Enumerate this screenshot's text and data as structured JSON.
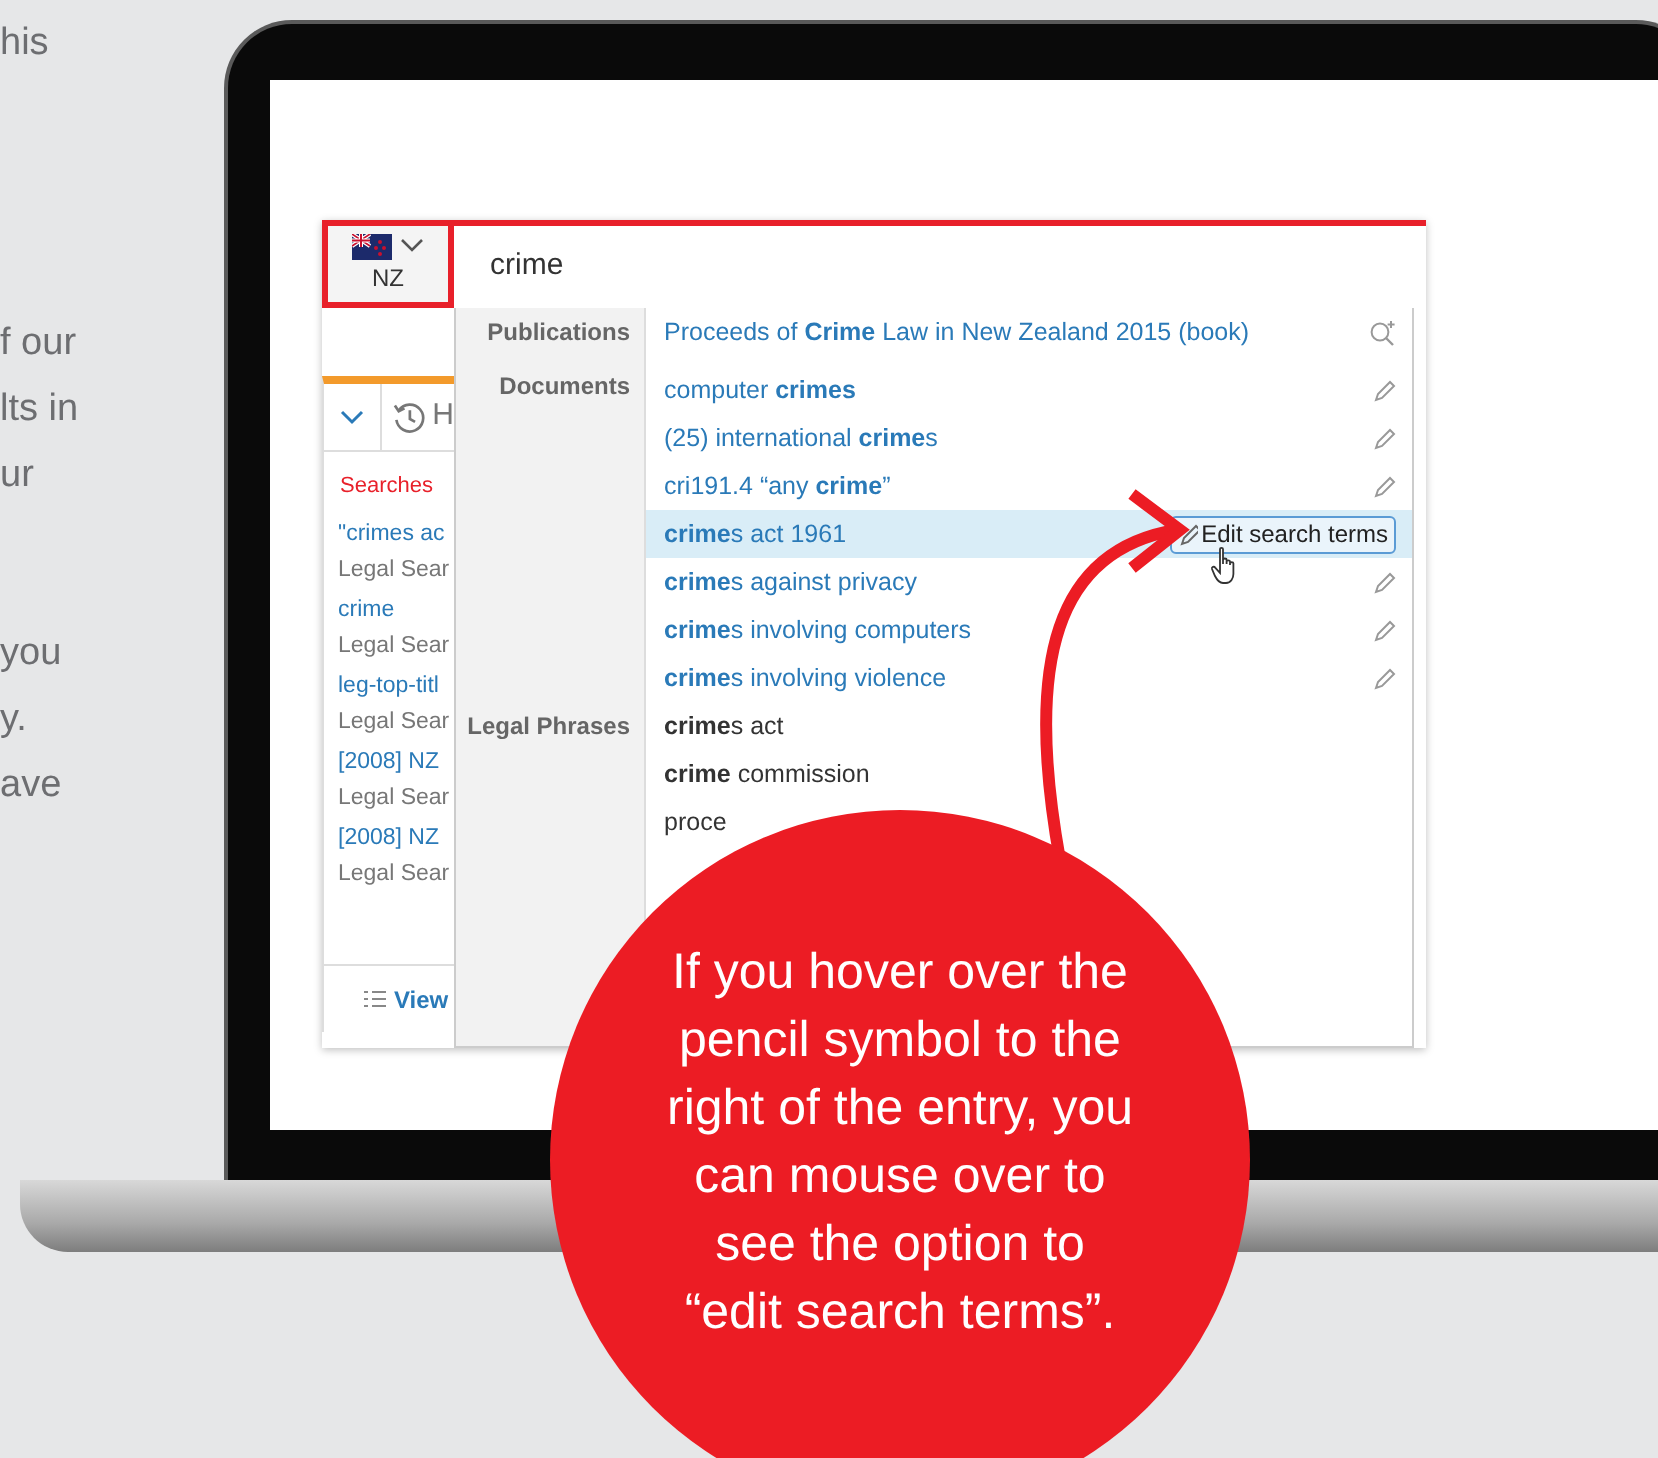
{
  "left_text": {
    "paragraphs": [
      [
        "his"
      ],
      [
        "f our",
        "lts in",
        "ur"
      ],
      [
        "you",
        "y.",
        "ave"
      ]
    ]
  },
  "app": {
    "country": {
      "code": "NZ"
    },
    "search": {
      "value": "crime"
    },
    "history_panel": {
      "title": "H",
      "searches_label": "Searches",
      "footer": "View",
      "items": [
        {
          "title": "\"crimes ac",
          "source": "Legal Sear"
        },
        {
          "title": "crime",
          "source": "Legal Sear"
        },
        {
          "title": "leg-top-titl",
          "source": "Legal Sear"
        },
        {
          "title": "[2008] NZ",
          "source": "Legal Sear"
        },
        {
          "title": "[2008] NZ",
          "source": "Legal Sear"
        }
      ]
    },
    "suggestions": [
      {
        "category": "Publications",
        "items": [
          {
            "text": "Proceeds of **Crime** Law in New Zealand 2015 (book)",
            "kind": "publication",
            "selected": false
          }
        ]
      },
      {
        "category": "Documents",
        "items": [
          {
            "text": "computer **crimes**",
            "kind": "document",
            "selected": false
          },
          {
            "text": "(25) international **crime**s",
            "kind": "document",
            "selected": false
          },
          {
            "text": "cri191.4 “any **crime**”",
            "kind": "document",
            "selected": false
          },
          {
            "text": "**crime**s act 1961",
            "kind": "document",
            "selected": true,
            "edit_label": "Edit search terms"
          },
          {
            "text": "**crime**s against privacy",
            "kind": "document",
            "selected": false
          },
          {
            "text": "**crime**s involving computers",
            "kind": "document",
            "selected": false
          },
          {
            "text": "**crime**s involving violence",
            "kind": "document",
            "selected": false
          }
        ]
      },
      {
        "category": "Legal Phrases",
        "items": [
          {
            "text": "**crime**s act",
            "kind": "phrase",
            "selected": false
          },
          {
            "text": "**crime** commission",
            "kind": "phrase",
            "selected": false
          },
          {
            "text": "proce",
            "kind": "phrase",
            "selected": false
          }
        ]
      }
    ]
  },
  "callout": {
    "text": "If you hover over the pencil symbol to the right of the entry, you can mouse over to see the option to “edit search terms”."
  }
}
